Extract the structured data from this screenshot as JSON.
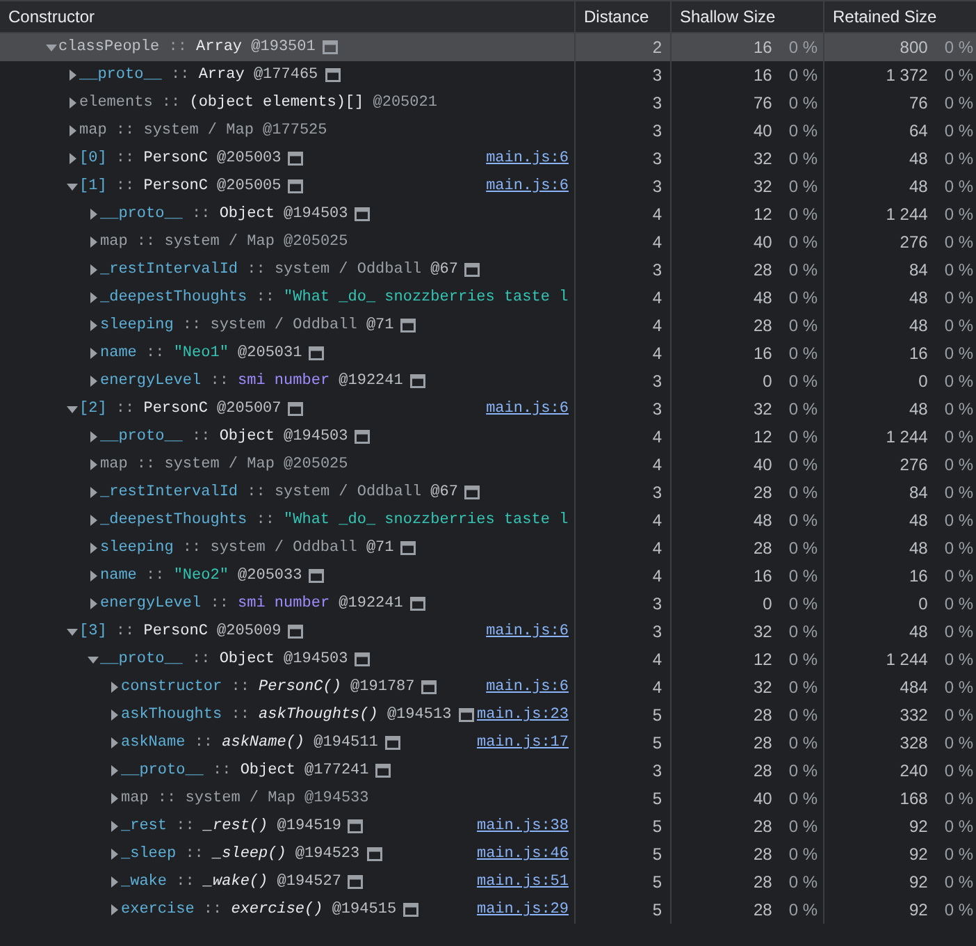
{
  "table": {
    "columns": [
      "Constructor",
      "Distance",
      "Shallow Size",
      "Retained Size"
    ],
    "rows": [
      {
        "name": {
          "text": "classPeople",
          "kind": "root"
        },
        "separator": "::",
        "value": {
          "text": "Array",
          "kind": "object"
        },
        "id": "@193501",
        "inspect_icon": true,
        "distance": "2",
        "shallow_size": "16",
        "shallow_percent": "0 %",
        "retained_size": "800",
        "retained_percent": "0 %",
        "expanded": true,
        "selected": true,
        "children": [
          {
            "name": {
              "text": "__proto__",
              "kind": "property"
            },
            "separator": "::",
            "value": {
              "text": "Array",
              "kind": "object"
            },
            "id": "@177465",
            "inspect_icon": true,
            "distance": "3",
            "shallow_size": "16",
            "shallow_percent": "0 %",
            "retained_size": "1 372",
            "retained_percent": "0 %",
            "expanded": false,
            "selected": false
          },
          {
            "name": {
              "text": "elements",
              "kind": "internal"
            },
            "separator": "::",
            "value": {
              "text": "(object elements)[]",
              "kind": "object"
            },
            "id": "@205021",
            "inspect_icon": false,
            "distance": "3",
            "shallow_size": "76",
            "shallow_percent": "0 %",
            "retained_size": "76",
            "retained_percent": "0 %",
            "expanded": false,
            "selected": false
          },
          {
            "name": {
              "text": "map",
              "kind": "internal"
            },
            "separator": "::",
            "value": {
              "text": "system / Map",
              "kind": "system"
            },
            "id": "@177525",
            "inspect_icon": false,
            "distance": "3",
            "shallow_size": "40",
            "shallow_percent": "0 %",
            "retained_size": "64",
            "retained_percent": "0 %",
            "expanded": false,
            "selected": false
          },
          {
            "name": {
              "text": "[0]",
              "kind": "property"
            },
            "separator": "::",
            "value": {
              "text": "PersonC",
              "kind": "object"
            },
            "id": "@205003",
            "inspect_icon": true,
            "link": "main.js:6",
            "distance": "3",
            "shallow_size": "32",
            "shallow_percent": "0 %",
            "retained_size": "48",
            "retained_percent": "0 %",
            "expanded": false,
            "selected": false
          },
          {
            "name": {
              "text": "[1]",
              "kind": "property"
            },
            "separator": "::",
            "value": {
              "text": "PersonC",
              "kind": "object"
            },
            "id": "@205005",
            "inspect_icon": true,
            "link": "main.js:6",
            "distance": "3",
            "shallow_size": "32",
            "shallow_percent": "0 %",
            "retained_size": "48",
            "retained_percent": "0 %",
            "expanded": true,
            "selected": false,
            "children": [
              {
                "name": {
                  "text": "__proto__",
                  "kind": "property"
                },
                "separator": "::",
                "value": {
                  "text": "Object",
                  "kind": "object"
                },
                "id": "@194503",
                "inspect_icon": true,
                "distance": "4",
                "shallow_size": "12",
                "shallow_percent": "0 %",
                "retained_size": "1 244",
                "retained_percent": "0 %",
                "expanded": false,
                "selected": false
              },
              {
                "name": {
                  "text": "map",
                  "kind": "internal"
                },
                "separator": "::",
                "value": {
                  "text": "system / Map",
                  "kind": "system"
                },
                "id": "@205025",
                "inspect_icon": false,
                "distance": "4",
                "shallow_size": "40",
                "shallow_percent": "0 %",
                "retained_size": "276",
                "retained_percent": "0 %",
                "expanded": false,
                "selected": false
              },
              {
                "name": {
                  "text": "_restIntervalId",
                  "kind": "property"
                },
                "separator": "::",
                "value": {
                  "text": "system / Oddball",
                  "kind": "system"
                },
                "id": "@67",
                "inspect_icon": true,
                "distance": "3",
                "shallow_size": "28",
                "shallow_percent": "0 %",
                "retained_size": "84",
                "retained_percent": "0 %",
                "expanded": false,
                "selected": false
              },
              {
                "name": {
                  "text": "_deepestThoughts",
                  "kind": "property"
                },
                "separator": "::",
                "value": {
                  "text": "\"What _do_ snozzberries taste l",
                  "kind": "string"
                },
                "inspect_icon": false,
                "distance": "4",
                "shallow_size": "48",
                "shallow_percent": "0 %",
                "retained_size": "48",
                "retained_percent": "0 %",
                "expanded": false,
                "selected": false
              },
              {
                "name": {
                  "text": "sleeping",
                  "kind": "property"
                },
                "separator": "::",
                "value": {
                  "text": "system / Oddball",
                  "kind": "system"
                },
                "id": "@71",
                "inspect_icon": true,
                "distance": "4",
                "shallow_size": "28",
                "shallow_percent": "0 %",
                "retained_size": "48",
                "retained_percent": "0 %",
                "expanded": false,
                "selected": false
              },
              {
                "name": {
                  "text": "name",
                  "kind": "property"
                },
                "separator": "::",
                "value": {
                  "text": "\"Neo1\"",
                  "kind": "string"
                },
                "id": "@205031",
                "inspect_icon": true,
                "distance": "4",
                "shallow_size": "16",
                "shallow_percent": "0 %",
                "retained_size": "16",
                "retained_percent": "0 %",
                "expanded": false,
                "selected": false
              },
              {
                "name": {
                  "text": "energyLevel",
                  "kind": "property"
                },
                "separator": "::",
                "value": {
                  "text": "smi number",
                  "kind": "number"
                },
                "id": "@192241",
                "inspect_icon": true,
                "distance": "3",
                "shallow_size": "0",
                "shallow_percent": "0 %",
                "retained_size": "0",
                "retained_percent": "0 %",
                "expanded": false,
                "selected": false
              }
            ]
          },
          {
            "name": {
              "text": "[2]",
              "kind": "property"
            },
            "separator": "::",
            "value": {
              "text": "PersonC",
              "kind": "object"
            },
            "id": "@205007",
            "inspect_icon": true,
            "link": "main.js:6",
            "distance": "3",
            "shallow_size": "32",
            "shallow_percent": "0 %",
            "retained_size": "48",
            "retained_percent": "0 %",
            "expanded": true,
            "selected": false,
            "children": [
              {
                "name": {
                  "text": "__proto__",
                  "kind": "property"
                },
                "separator": "::",
                "value": {
                  "text": "Object",
                  "kind": "object"
                },
                "id": "@194503",
                "inspect_icon": true,
                "distance": "4",
                "shallow_size": "12",
                "shallow_percent": "0 %",
                "retained_size": "1 244",
                "retained_percent": "0 %",
                "expanded": false,
                "selected": false
              },
              {
                "name": {
                  "text": "map",
                  "kind": "internal"
                },
                "separator": "::",
                "value": {
                  "text": "system / Map",
                  "kind": "system"
                },
                "id": "@205025",
                "inspect_icon": false,
                "distance": "4",
                "shallow_size": "40",
                "shallow_percent": "0 %",
                "retained_size": "276",
                "retained_percent": "0 %",
                "expanded": false,
                "selected": false
              },
              {
                "name": {
                  "text": "_restIntervalId",
                  "kind": "property"
                },
                "separator": "::",
                "value": {
                  "text": "system / Oddball",
                  "kind": "system"
                },
                "id": "@67",
                "inspect_icon": true,
                "distance": "3",
                "shallow_size": "28",
                "shallow_percent": "0 %",
                "retained_size": "84",
                "retained_percent": "0 %",
                "expanded": false,
                "selected": false
              },
              {
                "name": {
                  "text": "_deepestThoughts",
                  "kind": "property"
                },
                "separator": "::",
                "value": {
                  "text": "\"What _do_ snozzberries taste l",
                  "kind": "string"
                },
                "inspect_icon": false,
                "distance": "4",
                "shallow_size": "48",
                "shallow_percent": "0 %",
                "retained_size": "48",
                "retained_percent": "0 %",
                "expanded": false,
                "selected": false
              },
              {
                "name": {
                  "text": "sleeping",
                  "kind": "property"
                },
                "separator": "::",
                "value": {
                  "text": "system / Oddball",
                  "kind": "system"
                },
                "id": "@71",
                "inspect_icon": true,
                "distance": "4",
                "shallow_size": "28",
                "shallow_percent": "0 %",
                "retained_size": "48",
                "retained_percent": "0 %",
                "expanded": false,
                "selected": false
              },
              {
                "name": {
                  "text": "name",
                  "kind": "property"
                },
                "separator": "::",
                "value": {
                  "text": "\"Neo2\"",
                  "kind": "string"
                },
                "id": "@205033",
                "inspect_icon": true,
                "distance": "4",
                "shallow_size": "16",
                "shallow_percent": "0 %",
                "retained_size": "16",
                "retained_percent": "0 %",
                "expanded": false,
                "selected": false
              },
              {
                "name": {
                  "text": "energyLevel",
                  "kind": "property"
                },
                "separator": "::",
                "value": {
                  "text": "smi number",
                  "kind": "number"
                },
                "id": "@192241",
                "inspect_icon": true,
                "distance": "3",
                "shallow_size": "0",
                "shallow_percent": "0 %",
                "retained_size": "0",
                "retained_percent": "0 %",
                "expanded": false,
                "selected": false
              }
            ]
          },
          {
            "name": {
              "text": "[3]",
              "kind": "property"
            },
            "separator": "::",
            "value": {
              "text": "PersonC",
              "kind": "object"
            },
            "id": "@205009",
            "inspect_icon": true,
            "link": "main.js:6",
            "distance": "3",
            "shallow_size": "32",
            "shallow_percent": "0 %",
            "retained_size": "48",
            "retained_percent": "0 %",
            "expanded": true,
            "selected": false,
            "children": [
              {
                "name": {
                  "text": "__proto__",
                  "kind": "property"
                },
                "separator": "::",
                "value": {
                  "text": "Object",
                  "kind": "object"
                },
                "id": "@194503",
                "inspect_icon": true,
                "distance": "4",
                "shallow_size": "12",
                "shallow_percent": "0 %",
                "retained_size": "1 244",
                "retained_percent": "0 %",
                "expanded": true,
                "selected": false,
                "children": [
                  {
                    "name": {
                      "text": "constructor",
                      "kind": "property"
                    },
                    "separator": "::",
                    "value": {
                      "text": "PersonC()",
                      "kind": "function"
                    },
                    "id": "@191787",
                    "inspect_icon": true,
                    "link": "main.js:6",
                    "distance": "4",
                    "shallow_size": "32",
                    "shallow_percent": "0 %",
                    "retained_size": "484",
                    "retained_percent": "0 %",
                    "expanded": false,
                    "selected": false
                  },
                  {
                    "name": {
                      "text": "askThoughts",
                      "kind": "property"
                    },
                    "separator": "::",
                    "value": {
                      "text": "askThoughts()",
                      "kind": "function"
                    },
                    "id": "@194513",
                    "inspect_icon": true,
                    "link": "main.js:23",
                    "distance": "5",
                    "shallow_size": "28",
                    "shallow_percent": "0 %",
                    "retained_size": "332",
                    "retained_percent": "0 %",
                    "expanded": false,
                    "selected": false
                  },
                  {
                    "name": {
                      "text": "askName",
                      "kind": "property"
                    },
                    "separator": "::",
                    "value": {
                      "text": "askName()",
                      "kind": "function"
                    },
                    "id": "@194511",
                    "inspect_icon": true,
                    "link": "main.js:17",
                    "distance": "5",
                    "shallow_size": "28",
                    "shallow_percent": "0 %",
                    "retained_size": "328",
                    "retained_percent": "0 %",
                    "expanded": false,
                    "selected": false
                  },
                  {
                    "name": {
                      "text": "__proto__",
                      "kind": "property"
                    },
                    "separator": "::",
                    "value": {
                      "text": "Object",
                      "kind": "object"
                    },
                    "id": "@177241",
                    "inspect_icon": true,
                    "distance": "3",
                    "shallow_size": "28",
                    "shallow_percent": "0 %",
                    "retained_size": "240",
                    "retained_percent": "0 %",
                    "expanded": false,
                    "selected": false
                  },
                  {
                    "name": {
                      "text": "map",
                      "kind": "internal"
                    },
                    "separator": "::",
                    "value": {
                      "text": "system / Map",
                      "kind": "system"
                    },
                    "id": "@194533",
                    "inspect_icon": false,
                    "distance": "5",
                    "shallow_size": "40",
                    "shallow_percent": "0 %",
                    "retained_size": "168",
                    "retained_percent": "0 %",
                    "expanded": false,
                    "selected": false
                  },
                  {
                    "name": {
                      "text": "_rest",
                      "kind": "property"
                    },
                    "separator": "::",
                    "value": {
                      "text": "_rest()",
                      "kind": "function"
                    },
                    "id": "@194519",
                    "inspect_icon": true,
                    "link": "main.js:38",
                    "distance": "5",
                    "shallow_size": "28",
                    "shallow_percent": "0 %",
                    "retained_size": "92",
                    "retained_percent": "0 %",
                    "expanded": false,
                    "selected": false
                  },
                  {
                    "name": {
                      "text": "_sleep",
                      "kind": "property"
                    },
                    "separator": "::",
                    "value": {
                      "text": "_sleep()",
                      "kind": "function"
                    },
                    "id": "@194523",
                    "inspect_icon": true,
                    "link": "main.js:46",
                    "distance": "5",
                    "shallow_size": "28",
                    "shallow_percent": "0 %",
                    "retained_size": "92",
                    "retained_percent": "0 %",
                    "expanded": false,
                    "selected": false
                  },
                  {
                    "name": {
                      "text": "_wake",
                      "kind": "property"
                    },
                    "separator": "::",
                    "value": {
                      "text": "_wake()",
                      "kind": "function"
                    },
                    "id": "@194527",
                    "inspect_icon": true,
                    "link": "main.js:51",
                    "distance": "5",
                    "shallow_size": "28",
                    "shallow_percent": "0 %",
                    "retained_size": "92",
                    "retained_percent": "0 %",
                    "expanded": false,
                    "selected": false
                  },
                  {
                    "name": {
                      "text": "exercise",
                      "kind": "property"
                    },
                    "separator": "::",
                    "value": {
                      "text": "exercise()",
                      "kind": "function"
                    },
                    "id": "@194515",
                    "inspect_icon": true,
                    "link": "main.js:29",
                    "distance": "5",
                    "shallow_size": "28",
                    "shallow_percent": "0 %",
                    "retained_size": "92",
                    "retained_percent": "0 %",
                    "expanded": false,
                    "selected": false
                  }
                ]
              }
            ]
          }
        ]
      }
    ]
  }
}
